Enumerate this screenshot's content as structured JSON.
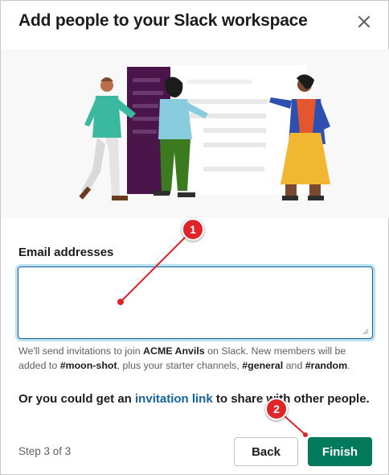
{
  "dialog": {
    "title": "Add people to your Slack workspace",
    "close_icon": "close-icon"
  },
  "illustration": {
    "icon": "people-collaborating-illustration"
  },
  "email": {
    "label": "Email addresses",
    "value": "",
    "placeholder": ""
  },
  "helper": {
    "part1": "We'll send invitations to join ",
    "workspace": "ACME Anvils",
    "part2": " on Slack. New members will be added to ",
    "channel1": "#moon-shot",
    "part3": ", plus your starter channels, ",
    "channel2": "#general",
    "part4": " and ",
    "channel3": "#random",
    "part5": "."
  },
  "invite": {
    "prefix": "Or you could get an ",
    "link": "invitation link",
    "suffix": " to share with other people."
  },
  "footer": {
    "step": "Step 3 of 3",
    "back_label": "Back",
    "finish_label": "Finish"
  },
  "annotations": {
    "marker1": "1",
    "marker2": "2",
    "color": "#e0252a"
  },
  "colors": {
    "accent_blue": "#1264a3",
    "finish_green": "#007a5a",
    "aubergine": "#4a154b"
  }
}
